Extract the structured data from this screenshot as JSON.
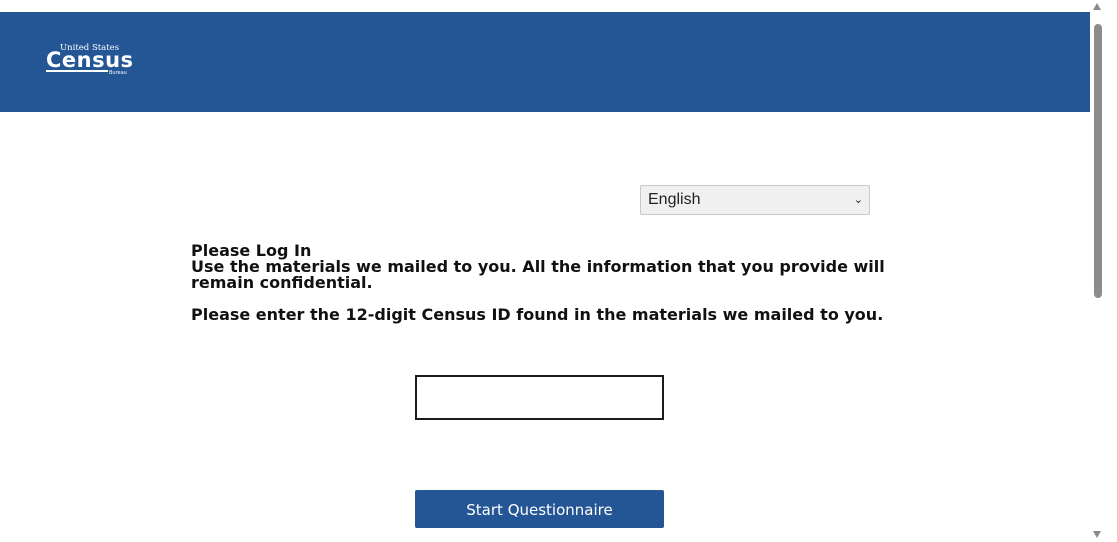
{
  "header": {
    "background_color": "#245595",
    "logo": {
      "top_text": "United States",
      "main_text": "Census",
      "bottom_text": "Bureau"
    }
  },
  "language_select": {
    "selected": "English",
    "icon": "chevron-down-icon"
  },
  "login": {
    "heading": "Please Log In",
    "instructions": "Use the materials we mailed to you. All the information that you provide will remain confidential.",
    "id_prompt": "Please enter the 12-digit Census ID found in the materials we mailed to you.",
    "census_id_value": ""
  },
  "actions": {
    "start_label": "Start Questionnaire",
    "button_color": "#245595"
  }
}
